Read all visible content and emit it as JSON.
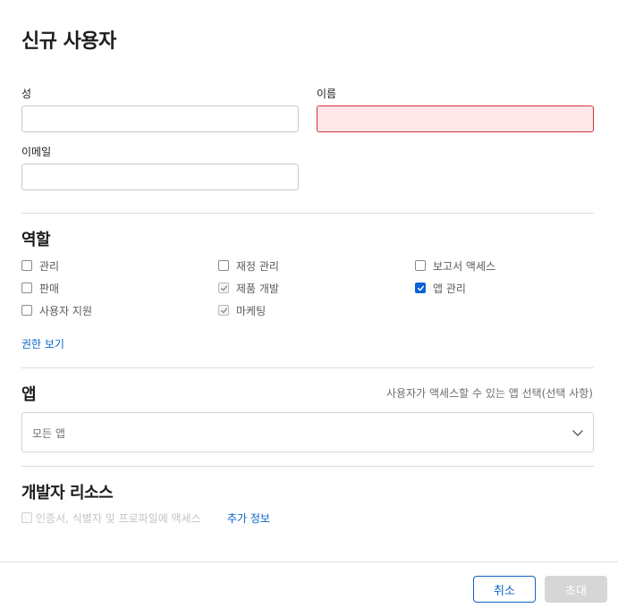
{
  "dialog": {
    "title": "신규 사용자"
  },
  "form": {
    "last_name_label": "성",
    "last_name_value": "",
    "first_name_label": "이름",
    "first_name_value": "",
    "email_label": "이메일",
    "email_value": ""
  },
  "roles": {
    "title": "역할",
    "items": [
      {
        "label": "관리",
        "state": "unchecked"
      },
      {
        "label": "재정 관리",
        "state": "unchecked"
      },
      {
        "label": "보고서 액세스",
        "state": "unchecked"
      },
      {
        "label": "판매",
        "state": "unchecked"
      },
      {
        "label": "제품 개발",
        "state": "checked-disabled"
      },
      {
        "label": "앱 관리",
        "state": "checked"
      },
      {
        "label": "사용자 지원",
        "state": "unchecked"
      },
      {
        "label": "마케팅",
        "state": "checked-disabled"
      }
    ],
    "view_permissions_link": "권한 보기"
  },
  "apps": {
    "title": "앱",
    "hint": "사용자가 액세스할 수 있는 앱 선택(선택 사항)",
    "select_value": "모든 앱"
  },
  "developer_resources": {
    "title": "개발자 리소스",
    "checkbox_label": "인증서, 식별자 및 프로파일에 액세스",
    "more_info_link": "추가 정보"
  },
  "footer": {
    "cancel_label": "취소",
    "invite_label": "초대"
  },
  "colors": {
    "accent": "#0a64c8",
    "error_border": "#d1333e",
    "error_fill": "#fde7e8",
    "disabled_button": "#d6d6d6"
  }
}
